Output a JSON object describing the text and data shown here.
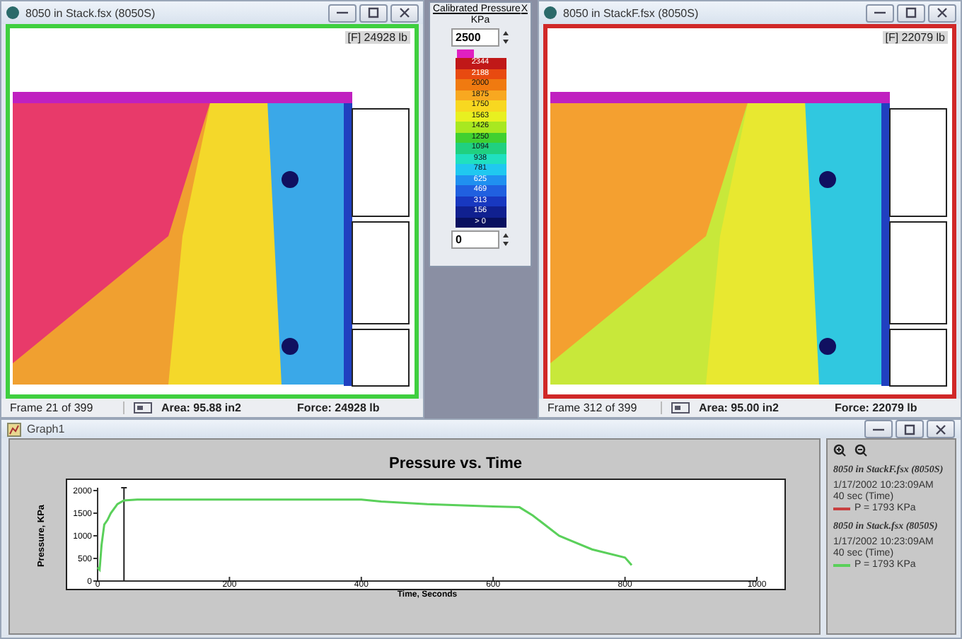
{
  "windows": [
    {
      "title": "8050 in Stack.fsx (8050S)",
      "color": "#3fcf3f",
      "force_badge": "[F] 24928 lb",
      "status": {
        "frame": "Frame 21 of 399",
        "area": "Area: 95.88 in2",
        "force": "Force: 24928 lb"
      }
    },
    {
      "title": "8050 in StackF.fsx (8050S)",
      "color": "#d02828",
      "force_badge": "[F] 22079 lb",
      "status": {
        "frame": "Frame 312 of 399",
        "area": "Area: 95.00 in2",
        "force": "Force: 22079 lb"
      }
    }
  ],
  "calibration": {
    "title": "Calibrated Pressure",
    "close": "X",
    "unit": "KPa",
    "max": "2500",
    "min": "0",
    "scale": [
      {
        "label": "2344",
        "color": "#c01818"
      },
      {
        "label": "2188",
        "color": "#e84a10"
      },
      {
        "label": "2000",
        "color": "#f07a10"
      },
      {
        "label": "1875",
        "color": "#f8a820"
      },
      {
        "label": "1750",
        "color": "#f8d820"
      },
      {
        "label": "1563",
        "color": "#e8f020"
      },
      {
        "label": "1426",
        "color": "#a8e820"
      },
      {
        "label": "1250",
        "color": "#40d030"
      },
      {
        "label": "1094",
        "color": "#20d080"
      },
      {
        "label": "938",
        "color": "#20e0c0"
      },
      {
        "label": "781",
        "color": "#20c8f0"
      },
      {
        "label": "625",
        "color": "#2090f0"
      },
      {
        "label": "469",
        "color": "#2060e0"
      },
      {
        "label": "313",
        "color": "#1838c0"
      },
      {
        "label": "156",
        "color": "#102090"
      },
      {
        "label": "> 0",
        "color": "#081060"
      }
    ]
  },
  "graph": {
    "title": "Graph1",
    "chart_data": {
      "type": "line",
      "title": "Pressure vs. Time",
      "xlabel": "Time, Seconds",
      "ylabel": "Pressure, KPa",
      "xlim": [
        0,
        1000
      ],
      "ylim": [
        0,
        2000
      ],
      "xticks": [
        0,
        200,
        400,
        600,
        800,
        1000
      ],
      "yticks": [
        0,
        500,
        1000,
        1500,
        2000
      ],
      "x": [
        0,
        3,
        6,
        10,
        15,
        20,
        30,
        40,
        60,
        100,
        200,
        300,
        400,
        430,
        500,
        600,
        640,
        660,
        700,
        750,
        800,
        810
      ],
      "series": [
        {
          "color": "#5ad05a",
          "values": [
            300,
            250,
            800,
            1250,
            1350,
            1500,
            1700,
            1780,
            1800,
            1800,
            1800,
            1800,
            1800,
            1760,
            1700,
            1650,
            1630,
            1450,
            1000,
            700,
            520,
            350
          ]
        }
      ],
      "ref_lines": [
        {
          "axis": "x",
          "value": 40
        }
      ]
    },
    "legend": [
      {
        "file": "8050 in StackF.fsx (8050S)",
        "date": "1/17/2002 10:23:09AM",
        "time": "40 sec (Time)",
        "reading": "P = 1793 KPa",
        "color": "#c84040"
      },
      {
        "file": "8050 in Stack.fsx (8050S)",
        "date": "1/17/2002 10:23:09AM",
        "time": "40 sec (Time)",
        "reading": "P = 1793 KPa",
        "color": "#5ad05a"
      }
    ]
  }
}
